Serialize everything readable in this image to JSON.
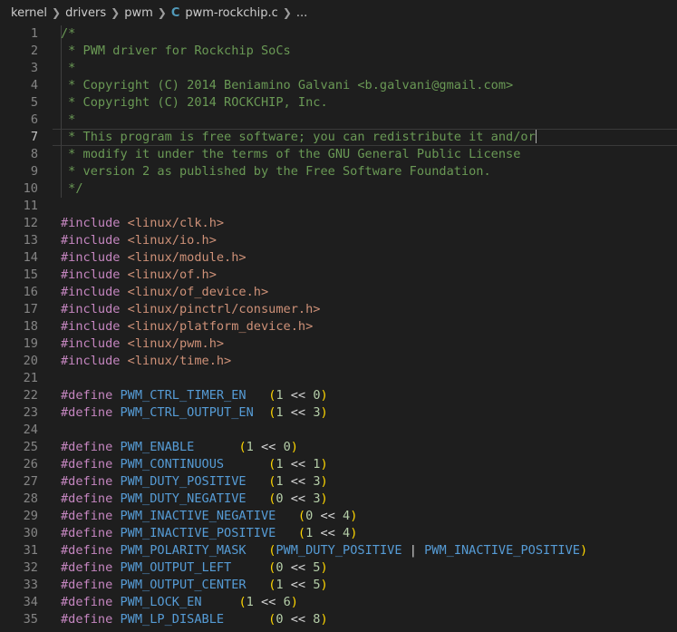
{
  "breadcrumb": {
    "items": [
      "kernel",
      "drivers",
      "pwm"
    ],
    "file_icon": "C",
    "file_name": "pwm-rockchip.c",
    "ellipsis": "..."
  },
  "editor": {
    "current_line": 7,
    "lines": [
      {
        "n": "1",
        "t": "comment",
        "text": "/*"
      },
      {
        "n": "2",
        "t": "comment",
        "text": " * PWM driver for Rockchip SoCs"
      },
      {
        "n": "3",
        "t": "comment",
        "text": " *"
      },
      {
        "n": "4",
        "t": "comment",
        "text": " * Copyright (C) 2014 Beniamino Galvani <b.galvani@gmail.com>"
      },
      {
        "n": "5",
        "t": "comment",
        "text": " * Copyright (C) 2014 ROCKCHIP, Inc."
      },
      {
        "n": "6",
        "t": "comment",
        "text": " *"
      },
      {
        "n": "7",
        "t": "comment",
        "text": " * This program is free software; you can redistribute it and/or"
      },
      {
        "n": "8",
        "t": "comment",
        "text": " * modify it under the terms of the GNU General Public License"
      },
      {
        "n": "9",
        "t": "comment",
        "text": " * version 2 as published by the Free Software Foundation."
      },
      {
        "n": "10",
        "t": "comment",
        "text": " */"
      },
      {
        "n": "11",
        "t": "blank",
        "text": ""
      },
      {
        "n": "12",
        "t": "include",
        "kw": "#include",
        "arg": " <linux/clk.h>"
      },
      {
        "n": "13",
        "t": "include",
        "kw": "#include",
        "arg": " <linux/io.h>"
      },
      {
        "n": "14",
        "t": "include",
        "kw": "#include",
        "arg": " <linux/module.h>"
      },
      {
        "n": "15",
        "t": "include",
        "kw": "#include",
        "arg": " <linux/of.h>"
      },
      {
        "n": "16",
        "t": "include",
        "kw": "#include",
        "arg": " <linux/of_device.h>"
      },
      {
        "n": "17",
        "t": "include",
        "kw": "#include",
        "arg": " <linux/pinctrl/consumer.h>"
      },
      {
        "n": "18",
        "t": "include",
        "kw": "#include",
        "arg": " <linux/platform_device.h>"
      },
      {
        "n": "19",
        "t": "include",
        "kw": "#include",
        "arg": " <linux/pwm.h>"
      },
      {
        "n": "20",
        "t": "include",
        "kw": "#include",
        "arg": " <linux/time.h>"
      },
      {
        "n": "21",
        "t": "blank",
        "text": ""
      },
      {
        "n": "22",
        "t": "define",
        "kw": "#define",
        "name": "PWM_CTRL_TIMER_EN",
        "pad": "   ",
        "a": "1",
        "b": "0"
      },
      {
        "n": "23",
        "t": "define",
        "kw": "#define",
        "name": "PWM_CTRL_OUTPUT_EN",
        "pad": "  ",
        "a": "1",
        "b": "3"
      },
      {
        "n": "24",
        "t": "blank",
        "text": ""
      },
      {
        "n": "25",
        "t": "define",
        "kw": "#define",
        "name": "PWM_ENABLE",
        "pad": "      ",
        "a": "1",
        "b": "0"
      },
      {
        "n": "26",
        "t": "define",
        "kw": "#define",
        "name": "PWM_CONTINUOUS",
        "pad": "      ",
        "a": "1",
        "b": "1"
      },
      {
        "n": "27",
        "t": "define",
        "kw": "#define",
        "name": "PWM_DUTY_POSITIVE",
        "pad": "   ",
        "a": "1",
        "b": "3"
      },
      {
        "n": "28",
        "t": "define",
        "kw": "#define",
        "name": "PWM_DUTY_NEGATIVE",
        "pad": "   ",
        "a": "0",
        "b": "3"
      },
      {
        "n": "29",
        "t": "define",
        "kw": "#define",
        "name": "PWM_INACTIVE_NEGATIVE",
        "pad": "   ",
        "a": "0",
        "b": "4"
      },
      {
        "n": "30",
        "t": "define",
        "kw": "#define",
        "name": "PWM_INACTIVE_POSITIVE",
        "pad": "   ",
        "a": "1",
        "b": "4"
      },
      {
        "n": "31",
        "t": "define_or",
        "kw": "#define",
        "name": "PWM_POLARITY_MASK",
        "pad": "   ",
        "x": "PWM_DUTY_POSITIVE",
        "y": "PWM_INACTIVE_POSITIVE"
      },
      {
        "n": "32",
        "t": "define",
        "kw": "#define",
        "name": "PWM_OUTPUT_LEFT",
        "pad": "     ",
        "a": "0",
        "b": "5"
      },
      {
        "n": "33",
        "t": "define",
        "kw": "#define",
        "name": "PWM_OUTPUT_CENTER",
        "pad": "   ",
        "a": "1",
        "b": "5"
      },
      {
        "n": "34",
        "t": "define",
        "kw": "#define",
        "name": "PWM_LOCK_EN",
        "pad": "     ",
        "a": "1",
        "b": "6"
      },
      {
        "n": "35",
        "t": "define",
        "kw": "#define",
        "name": "PWM_LP_DISABLE",
        "pad": "      ",
        "a": "0",
        "b": "8"
      }
    ]
  }
}
